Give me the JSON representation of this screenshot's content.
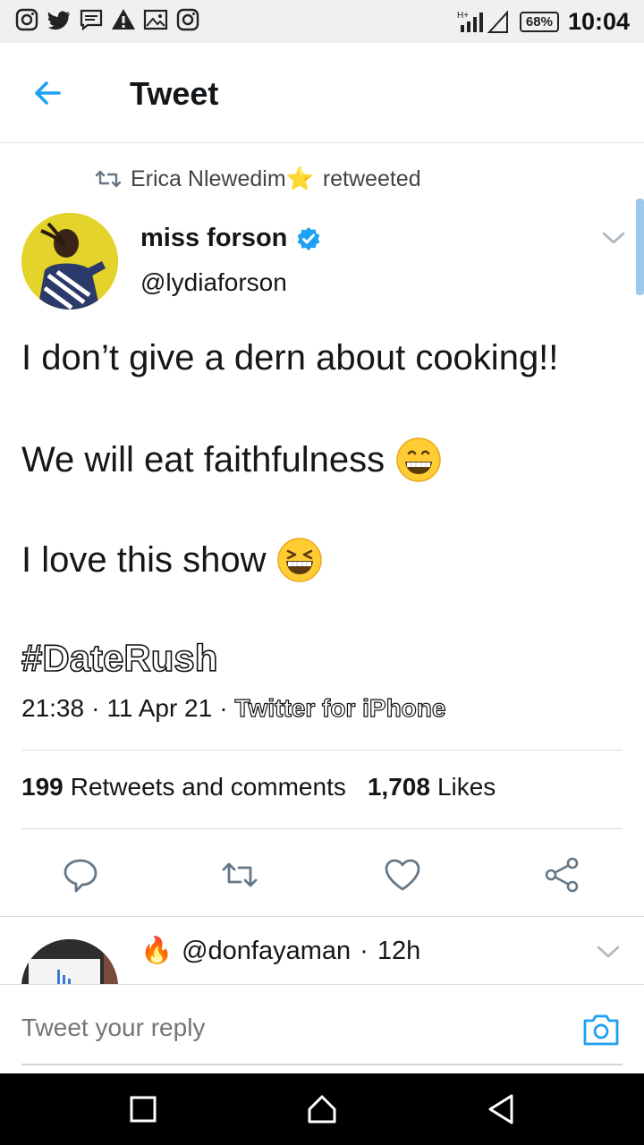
{
  "status_bar": {
    "icons_left": [
      "instagram-icon",
      "twitter-icon",
      "message-icon",
      "warning-icon",
      "image-icon",
      "instagram-icon"
    ],
    "battery": "68%",
    "time": "10:04"
  },
  "header": {
    "title": "Tweet"
  },
  "retweet_context": {
    "user": "Erica Nlewedim",
    "badge": "⭐",
    "action": "retweeted"
  },
  "author": {
    "name": "miss forson",
    "verified": true,
    "handle": "@lydiaforson"
  },
  "tweet": {
    "line1": "I don’t give a dern about cooking!!",
    "line2": "We will eat faithfulness",
    "line3": "I love this show",
    "hashtag": "#DateRush",
    "time": "21:38",
    "date": "11 Apr 21",
    "sep": "·",
    "source": "Twitter for iPhone"
  },
  "stats": {
    "retweets_count": "199",
    "retweets_label": "Retweets and comments",
    "likes_count": "1,708",
    "likes_label": "Likes"
  },
  "actions": [
    "reply-icon",
    "retweet-icon",
    "like-icon",
    "share-icon"
  ],
  "reply_preview": {
    "emoji": "🔥",
    "handle": "@donfayaman",
    "sep": "·",
    "age": "12h"
  },
  "composer": {
    "placeholder": "Tweet your reply"
  },
  "colors": {
    "accent": "#1da1f2",
    "text": "#14171a",
    "divider": "#d6dde2"
  }
}
